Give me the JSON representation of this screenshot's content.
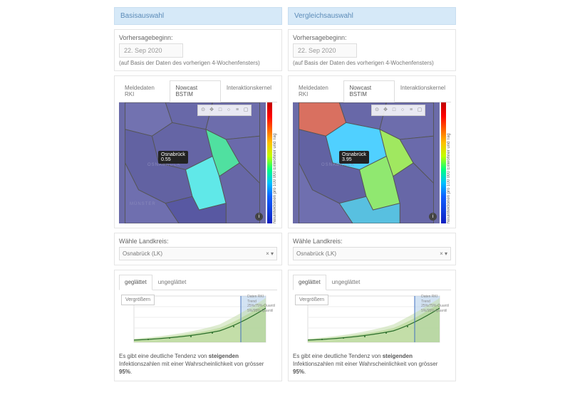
{
  "left": {
    "header": "Basisauswahl",
    "forecast_label": "Vorhersagebeginn:",
    "date": "22. Sep 2020",
    "date_hint": "(auf Basis der Daten des vorherigen 4-Wochenfensters)",
    "tabs": [
      "Meldedaten RKI",
      "Nowcast BSTIM",
      "Interaktionskernel"
    ],
    "active_tab": 1,
    "tooltip_title": "Osnabrück",
    "tooltip_val": "0.55",
    "colorbar_label": "Neuinfektionen pro 100 000 Einwohner und Tag",
    "landkreis_label": "Wähle Landkreis:",
    "landkreis_value": "Osnabrück (LK)",
    "smooth_tabs": [
      "geglättet",
      "ungeglättet"
    ],
    "smooth_active": 0,
    "enlarge": "Vergrößern",
    "legend": [
      "Daten RKI",
      "Trend",
      "25%/75%-Quantil",
      "5%/95%-Quantil"
    ],
    "trend_html": "Es gibt eine deutliche Tendenz von <b>steigenden</b> Infektionszahlen mit einer Wahrscheinlichkeit von grösser <b>95%</b>."
  },
  "right": {
    "header": "Vergleichsauswahl",
    "forecast_label": "Vorhersagebeginn:",
    "date": "22. Sep 2020",
    "date_hint": "(auf Basis der Daten des vorherigen 4-Wochenfensters)",
    "tabs": [
      "Meldedaten RKI",
      "Nowcast BSTIM",
      "Interaktionskernel"
    ],
    "active_tab": 1,
    "tooltip_title": "Osnabrück",
    "tooltip_val": "3.95",
    "colorbar_label": "Neuinfektionen pro 100 000 Einwohner und Tag",
    "landkreis_label": "Wähle Landkreis:",
    "landkreis_value": "Osnabrück (LK)",
    "smooth_tabs": [
      "geglättet",
      "ungeglättet"
    ],
    "smooth_active": 0,
    "enlarge": "Vergrößern",
    "legend": [
      "Daten RKI",
      "Trend",
      "25%/75%-Quantil",
      "5%/95%-Quantil"
    ],
    "trend_html": "Es gibt eine deutliche Tendenz von <b>steigenden</b> Infektionszahlen mit einer Wahrscheinlichkeit von grösser <b>95%</b>."
  },
  "map_labels": {
    "osnabruck": "OSNABRÜCK",
    "munster": "MÜNSTER"
  },
  "toolbar_icons": [
    "⊙",
    "✥",
    "□",
    "○",
    "≡",
    "▢"
  ]
}
